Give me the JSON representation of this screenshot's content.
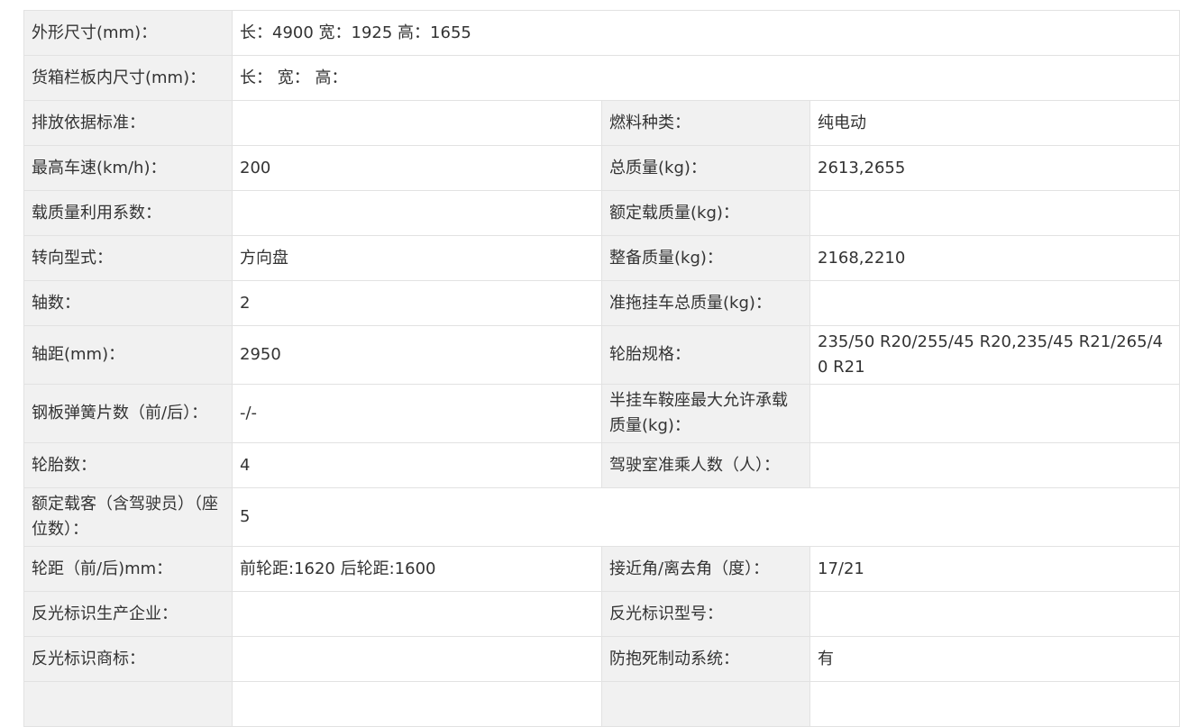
{
  "rows": [
    {
      "l1": "外形尺寸(mm)：",
      "v1": "长：4900 宽：1925 高：1655"
    },
    {
      "l1": "货箱栏板内尺寸(mm)：",
      "v1": "长： 宽： 高："
    },
    {
      "l1": "排放依据标准：",
      "v1": "",
      "l2": "燃料种类：",
      "v2": "纯电动"
    },
    {
      "l1": "最高车速(km/h)：",
      "v1": "200",
      "l2": "总质量(kg)：",
      "v2": "2613,2655"
    },
    {
      "l1": "载质量利用系数：",
      "v1": "",
      "l2": "额定载质量(kg)：",
      "v2": ""
    },
    {
      "l1": "转向型式：",
      "v1": "方向盘",
      "l2": "整备质量(kg)：",
      "v2": "2168,2210"
    },
    {
      "l1": "轴数：",
      "v1": "2",
      "l2": "准拖挂车总质量(kg)：",
      "v2": ""
    },
    {
      "l1": "轴距(mm)：",
      "v1": "2950",
      "l2": "轮胎规格：",
      "v2": "235/50 R20/255/45 R20,235/45 R21/265/40 R21"
    },
    {
      "l1": "钢板弹簧片数（前/后）：",
      "v1": "-/-",
      "l2": "半挂车鞍座最大允许承载质量(kg)：",
      "v2": ""
    },
    {
      "l1": "轮胎数：",
      "v1": "4",
      "l2": "驾驶室准乘人数（人）：",
      "v2": ""
    },
    {
      "l1": "额定载客（含驾驶员）（座位数）：",
      "v1": "5"
    },
    {
      "l1": "轮距（前/后)mm：",
      "v1": "前轮距:1620 后轮距:1600",
      "l2": "接近角/离去角（度）：",
      "v2": "17/21"
    },
    {
      "l1": "反光标识生产企业：",
      "v1": "",
      "l2": "反光标识型号：",
      "v2": ""
    },
    {
      "l1": "反光标识商标：",
      "v1": "",
      "l2": "防抱死制动系统：",
      "v2": "有"
    }
  ]
}
